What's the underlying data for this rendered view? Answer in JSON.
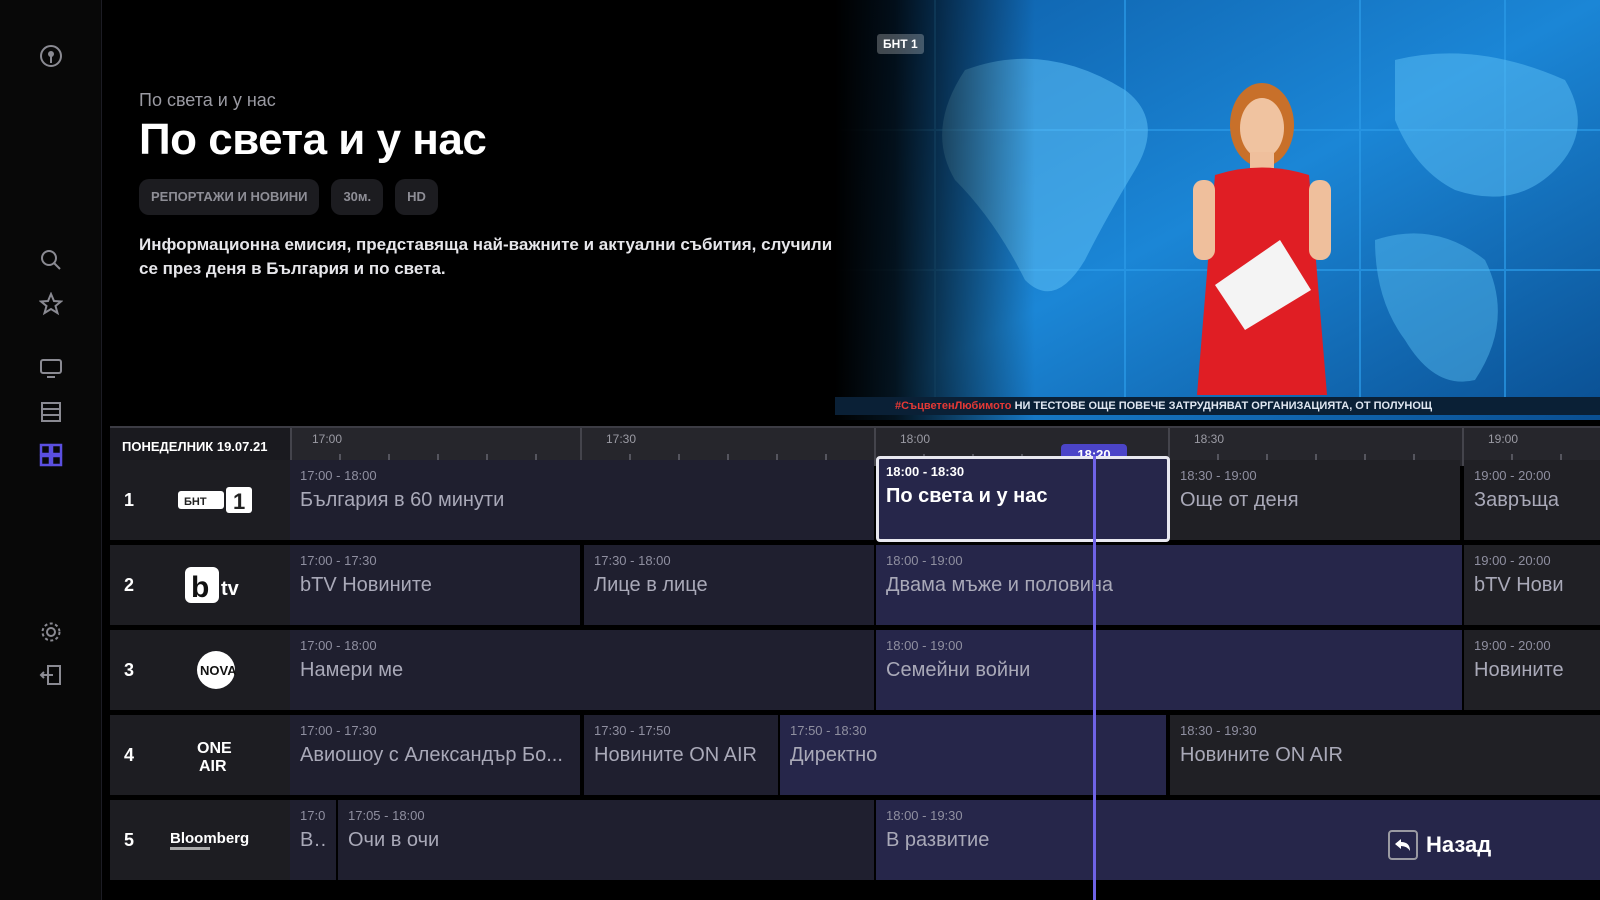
{
  "sidebar": {
    "icons": [
      "account-icon",
      "search-icon",
      "favorites-star-icon",
      "tv-icon",
      "film-icon",
      "grid-icon",
      "settings-gear-icon",
      "exit-icon"
    ],
    "active_color": "#5b4fe0"
  },
  "program_info": {
    "subtitle": "По света и у нас",
    "title": "По света и у нас",
    "tags": [
      "РЕПОРТАЖИ И НОВИНИ",
      "30м.",
      "HD"
    ],
    "description": "Информационна емисия, представяща най-важните и актуални събития, случили се през деня в България и по света."
  },
  "video": {
    "channel_logo": "БНТ 1",
    "ticker_red": "#СъцветенЛюбимото",
    "ticker_text": "НИ ТЕСТОВЕ ОЩЕ ПОВЕЧЕ ЗАТРУДНЯВАТ ОРГАНИЗАЦИЯТА, ОТ ПОЛУНОЩ"
  },
  "epg": {
    "date": "ПОНЕДЕЛНИК 19.07.21",
    "times": [
      "17:00",
      "17:30",
      "18:00",
      "18:30",
      "19:00"
    ],
    "now": "18:20",
    "channels": [
      {
        "number": "1",
        "logo": "БНТ 1",
        "programs": [
          {
            "time": "17:00 - 18:00",
            "name": "България в 60 минути",
            "state": "past"
          },
          {
            "time": "18:00 - 18:30",
            "name": "По света и у нас",
            "state": "sel"
          },
          {
            "time": "18:30 - 19:00",
            "name": "Още от деня",
            "state": "future"
          },
          {
            "time": "19:00 - 20:00",
            "name": "Завръща",
            "state": "future"
          }
        ]
      },
      {
        "number": "2",
        "logo": "btv",
        "programs": [
          {
            "time": "17:00 - 17:30",
            "name": "bTV Новините",
            "state": "past"
          },
          {
            "time": "17:30 - 18:00",
            "name": "Лице в лице",
            "state": "past"
          },
          {
            "time": "18:00 - 19:00",
            "name": "Двама мъже и половина",
            "state": "cur"
          },
          {
            "time": "19:00 - 20:00",
            "name": "bTV Нови",
            "state": "future"
          }
        ]
      },
      {
        "number": "3",
        "logo": "NOVA",
        "programs": [
          {
            "time": "17:00 - 18:00",
            "name": "Намери ме",
            "state": "past"
          },
          {
            "time": "18:00 - 19:00",
            "name": "Семейни войни",
            "state": "cur"
          },
          {
            "time": "19:00 - 20:00",
            "name": "Новините",
            "state": "future"
          }
        ]
      },
      {
        "number": "4",
        "logo": "ONE AIR",
        "programs": [
          {
            "time": "17:00 - 17:30",
            "name": "Авиошоу с Александър Бо...",
            "state": "past"
          },
          {
            "time": "17:30 - 17:50",
            "name": "Новините ON AIR",
            "state": "past"
          },
          {
            "time": "17:50 - 18:30",
            "name": "Директно",
            "state": "cur"
          },
          {
            "time": "18:30 - 19:30",
            "name": "Новините ON AIR",
            "state": "future"
          }
        ]
      },
      {
        "number": "5",
        "logo": "Bloomberg",
        "programs": [
          {
            "time": "17:0",
            "name": "В...",
            "state": "past"
          },
          {
            "time": "17:05 - 18:00",
            "name": "Очи в очи",
            "state": "past"
          },
          {
            "time": "18:00 - 19:30",
            "name": "В развитие",
            "state": "cur"
          }
        ]
      }
    ]
  },
  "back": {
    "label": "Назад"
  }
}
